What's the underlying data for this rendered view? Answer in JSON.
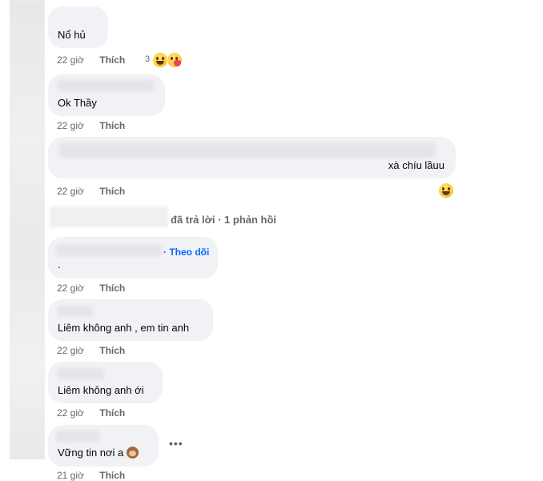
{
  "comments": [
    {
      "text": "Nổ hủ",
      "time": "22 giờ",
      "like": "Thích",
      "reaction_count": "3",
      "reactions": [
        "haha-icon",
        "care-icon"
      ]
    },
    {
      "text": "Ok Thầy",
      "time": "22 giờ",
      "like": "Thích"
    },
    {
      "text": "xà chíu lầuu",
      "time": "22 giờ",
      "like": "Thích",
      "reactions": [
        "haha-icon"
      ]
    },
    {
      "text": ".",
      "time": "22 giờ",
      "like": "Thích",
      "follow": "· Theo dõi"
    },
    {
      "text": "Liêm không anh , em tin anh",
      "time": "22 giờ",
      "like": "Thích"
    },
    {
      "text": "Liêm không anh ới",
      "time": "22 giờ",
      "like": "Thích"
    },
    {
      "text": "Vững tin nơi a",
      "time": "21 giờ",
      "like": "Thích",
      "emoji": "see-no-evil-monkey-icon"
    }
  ],
  "reply_summary": "đã trả lời · 1 phản hồi",
  "more_label": "•••",
  "colors": {
    "bubble_bg": "#f0f2f5",
    "meta_text": "#65676b",
    "follow_link": "#0866ff"
  }
}
